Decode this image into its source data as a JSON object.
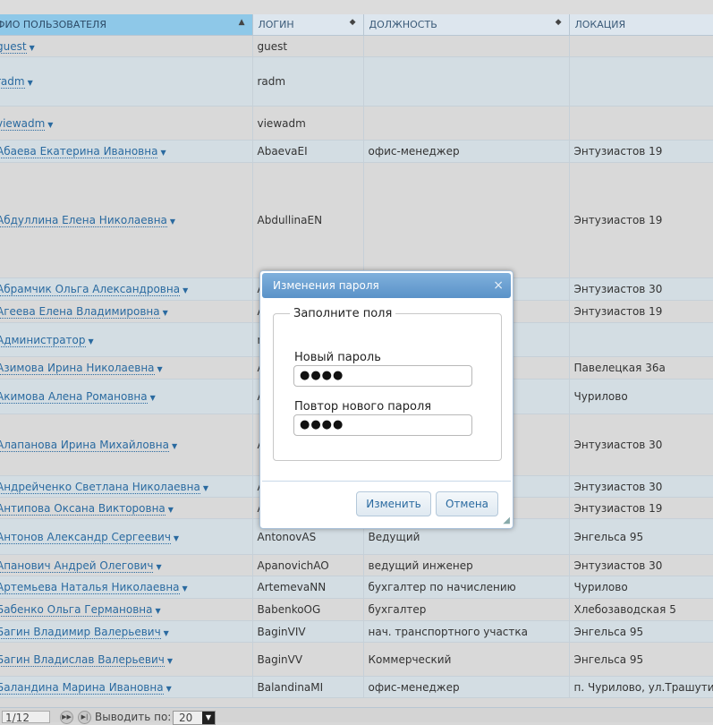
{
  "table": {
    "headers": [
      {
        "label": "ФИО ПОЛЬЗОВАТЕЛЯ",
        "sort": "▲"
      },
      {
        "label": "ЛОГИН",
        "sort": "◆"
      },
      {
        "label": "ДОЛЖНОСТЬ",
        "sort": "◆"
      },
      {
        "label": "ЛОКАЦИЯ",
        "sort": ""
      }
    ],
    "rows": [
      {
        "name": "guest",
        "login": "guest",
        "position": "",
        "location": ""
      },
      {
        "name": "radm",
        "login": "radm",
        "position": "",
        "location": ""
      },
      {
        "name": "viewadm",
        "login": "viewadm",
        "position": "",
        "location": ""
      },
      {
        "name": "Абаева Екатерина Ивановна",
        "login": "AbaevaEI",
        "position": "офис-менеджер",
        "location": "Энтузиастов 19"
      },
      {
        "name": "Абдуллина Елена Николаевна",
        "login": "AbdullinaEN",
        "position": "",
        "location": "Энтузиастов 19"
      },
      {
        "name": "Абрамчик Ольга Александровна",
        "login": "Avram",
        "position": "",
        "location": "Энтузиастов 30"
      },
      {
        "name": "Агеева Елена Владимировна",
        "login": "Ageev",
        "position": "",
        "location": "Энтузиастов 19"
      },
      {
        "name": "Администратор",
        "login": "mantis",
        "position": "",
        "location": ""
      },
      {
        "name": "Азимова Ирина Николаевна",
        "login": "Azimo",
        "position": "",
        "location": "Павелецкая 36а"
      },
      {
        "name": "Акимова Алена Романовна",
        "login": "Akimo",
        "position": "",
        "location": "Чурилово"
      },
      {
        "name": "Алапанова Ирина Михайловна",
        "login": "Alapan",
        "position": "",
        "location": "Энтузиастов 30"
      },
      {
        "name": "Андрейченко Светлана Николаевна",
        "login": "Andrey",
        "position": "",
        "location": "Энтузиастов 30"
      },
      {
        "name": "Антипова Оксана Викторовна",
        "login": "Antipo",
        "position": "",
        "location": "Энтузиастов 19"
      },
      {
        "name": "Антонов Александр Сергеевич",
        "login": "AntonovAS",
        "position": "Ведущий",
        "location": "Энгельса 95"
      },
      {
        "name": "Апанович Андрей Олегович",
        "login": "ApanovichAO",
        "position": "ведущий инженер",
        "location": "Энтузиастов 30"
      },
      {
        "name": "Артемьева Наталья Николаевна",
        "login": "ArtemevaNN",
        "position": "бухгалтер по начислению",
        "location": "Чурилово"
      },
      {
        "name": "Бабенко Ольга Германовна",
        "login": "BabenkoOG",
        "position": "бухгалтер",
        "location": "Хлебозаводская 5"
      },
      {
        "name": "Багин Владимир Валерьевич",
        "login": "BaginVIV",
        "position": "нач. транспортного участка",
        "location": "Энгельса 95"
      },
      {
        "name": "Багин Владислав Валерьевич",
        "login": "BaginVV",
        "position": "Коммерческий",
        "location": "Энгельса 95"
      },
      {
        "name": "Баландина Марина Ивановна",
        "login": "BalandinaMI",
        "position": "офис-менеджер",
        "location": "п. Чурилово, ул.Трашутина,д.49,кв"
      }
    ]
  },
  "pager": {
    "page": "1/12",
    "next_icon": "next-page-icon",
    "last_icon": "last-page-icon",
    "per_page_label": "Выводить по:",
    "per_page_value": "20"
  },
  "dialog": {
    "title": "Изменения пароля",
    "close_glyph": "×",
    "legend": "Заполните поля",
    "new_password_label": "Новый пароль",
    "new_password_value": "●●●●",
    "repeat_password_label": "Повтор нового пароля",
    "repeat_password_value": "●●●●",
    "submit_label": "Изменить",
    "cancel_label": "Отмена"
  }
}
